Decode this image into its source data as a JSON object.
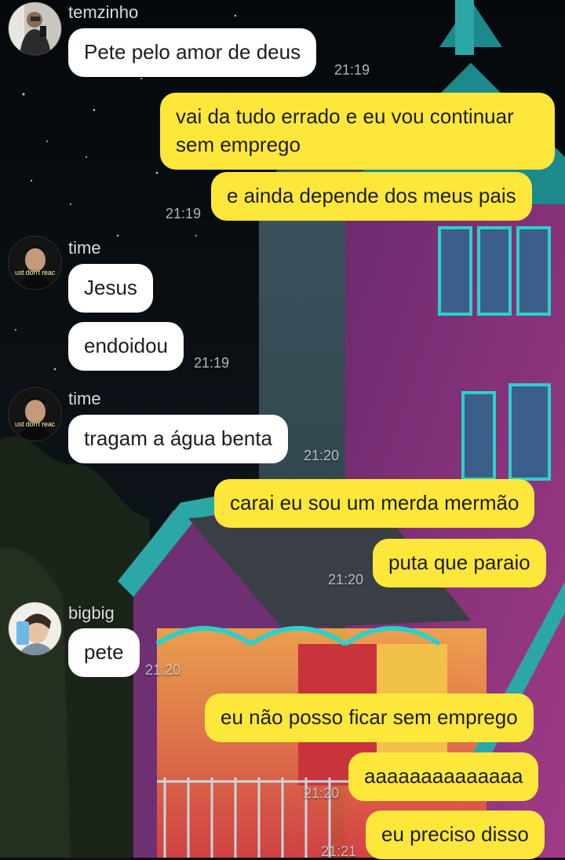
{
  "colors": {
    "outgoing_bubble": "#fde73b",
    "incoming_bubble": "#ffffff",
    "text": "#1d1d1d",
    "meta_text": "#d9dde2"
  },
  "senders": {
    "temzinho": "temzinho",
    "time": "time",
    "bigbig": "bigbig"
  },
  "avatar_caption": "ust don't reac",
  "messages": [
    {
      "text": "Pete pelo amor de deus",
      "from": "temzinho",
      "time": "21:19"
    },
    {
      "text": "vai da tudo errado e eu vou continuar sem emprego",
      "from": "me"
    },
    {
      "text": "e ainda depende dos meus pais",
      "from": "me",
      "time": "21:19"
    },
    {
      "text": "Jesus",
      "from": "time"
    },
    {
      "text": "endoidou",
      "from": "time",
      "time": "21:19"
    },
    {
      "text": "tragam a água benta",
      "from": "time",
      "time": "21:20"
    },
    {
      "text": "carai eu sou um merda mermão",
      "from": "me"
    },
    {
      "text": "puta que paraio",
      "from": "me",
      "time": "21:20"
    },
    {
      "text": "pete",
      "from": "bigbig",
      "time": "21:20"
    },
    {
      "text": "eu não posso ficar sem emprego",
      "from": "me"
    },
    {
      "text": "aaaaaaaaaaaaaa",
      "from": "me",
      "time": "21:20"
    },
    {
      "text": "eu preciso disso",
      "from": "me",
      "time": "21:21"
    }
  ]
}
